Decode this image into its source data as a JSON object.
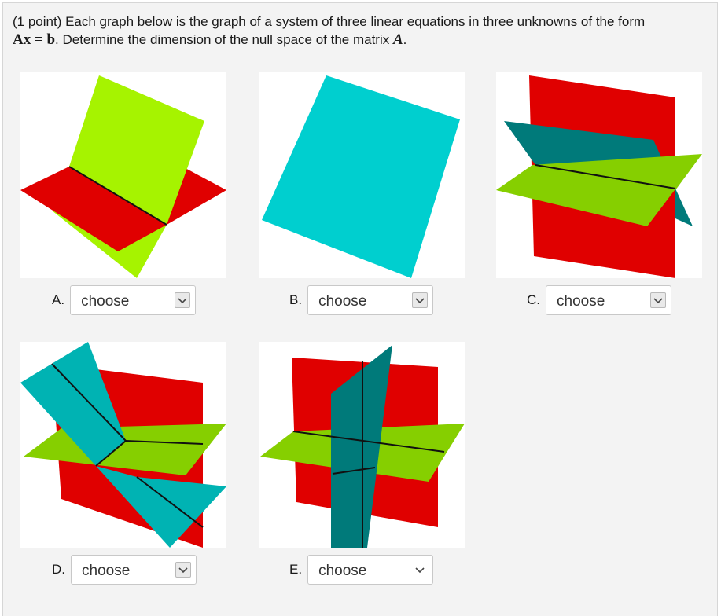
{
  "prompt": {
    "text_before": "(1 point) Each graph below is the graph of a system of three linear equations in three unknowns of the form",
    "eq_A": "A",
    "eq_x": "x",
    "eq_equals": " = ",
    "eq_b": "b",
    "text_after": ". Determine the dimension of the null space of the matrix ",
    "matrix": "A",
    "period": "."
  },
  "colors": {
    "background": "#f3f3f3",
    "plane_lime": "#a6f300",
    "plane_red": "#e00000",
    "plane_cyan": "#00cfcf",
    "plane_teal": "#007a7a",
    "plane_green": "#86cf00"
  },
  "graphs": [
    {
      "id": "A",
      "label": "A.",
      "select_value": "choose",
      "icon": "chevron-down-icon"
    },
    {
      "id": "B",
      "label": "B.",
      "select_value": "choose",
      "icon": "chevron-down-icon"
    },
    {
      "id": "C",
      "label": "C.",
      "select_value": "choose",
      "icon": "chevron-down-icon"
    },
    {
      "id": "D",
      "label": "D.",
      "select_value": "choose",
      "icon": "chevron-down-icon"
    },
    {
      "id": "E",
      "label": "E.",
      "select_value": "choose",
      "icon": "chevron-down-icon"
    }
  ]
}
